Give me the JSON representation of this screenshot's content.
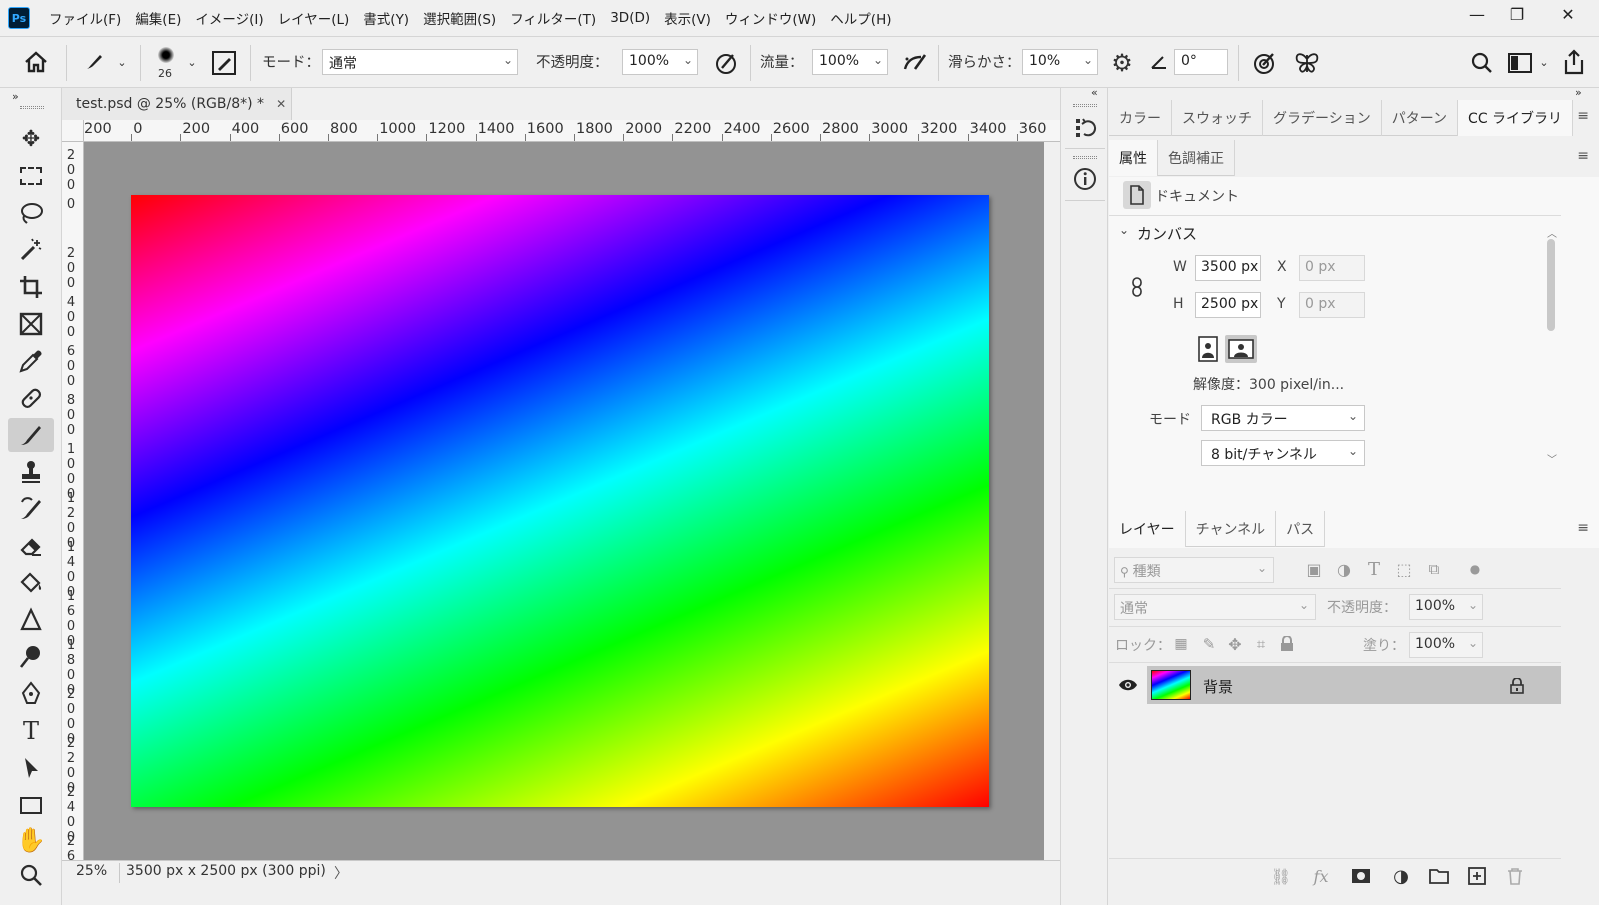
{
  "app": {
    "logo_text": "Ps"
  },
  "menubar": {
    "items": [
      "ファイル(F)",
      "編集(E)",
      "イメージ(I)",
      "レイヤー(L)",
      "書式(Y)",
      "選択範囲(S)",
      "フィルター(T)",
      "3D(D)",
      "表示(V)",
      "ウィンドウ(W)",
      "ヘルプ(H)"
    ]
  },
  "window_controls": {
    "minimize": "—",
    "restore": "❐",
    "close": "✕"
  },
  "options_bar": {
    "brush_size": "26",
    "mode_label": "モード：",
    "mode_value": "通常",
    "opacity_label": "不透明度：",
    "opacity_value": "100%",
    "flow_label": "流量：",
    "flow_value": "100%",
    "smoothing_label": "滑らかさ：",
    "smoothing_value": "10%",
    "angle_value": "0°"
  },
  "document": {
    "tab_title": "test.psd @ 25% (RGB/8*) *",
    "hruler_ticks": [
      "200",
      "0",
      "200",
      "400",
      "600",
      "800",
      "1000",
      "1200",
      "1400",
      "1600",
      "1800",
      "2000",
      "2200",
      "2400",
      "2600",
      "2800",
      "3000",
      "3200",
      "3400",
      "360"
    ],
    "vruler_ticks": [
      "200",
      "0",
      "200",
      "400",
      "600",
      "800",
      "1000",
      "1200",
      "1400",
      "1600",
      "1800",
      "2000",
      "2200",
      "2400",
      "26"
    ],
    "gradient_colors": [
      "#ff0000",
      "#ff00ff",
      "#0000ff",
      "#00ffff",
      "#00ff00",
      "#ffff00",
      "#ff0000"
    ]
  },
  "status_bar": {
    "zoom": "25%",
    "info": "3500 px x 2500 px (300 ppi)",
    "arrow": "〉"
  },
  "top_panel": {
    "tabs": [
      "カラー",
      "スウォッチ",
      "グラデーション",
      "パターン",
      "CC ライブラリ"
    ],
    "active_tab": "CC ライブラリ"
  },
  "properties_panel": {
    "tabs": [
      "属性",
      "色調補正"
    ],
    "doc_label": "ドキュメント",
    "section_title": "カンバス",
    "w_label": "W",
    "w_value": "3500 px",
    "h_label": "H",
    "h_value": "2500 px",
    "x_label": "X",
    "x_value": "0 px",
    "y_label": "Y",
    "y_value": "0 px",
    "resolution": "解像度：300 pixel/in...",
    "mode_label": "モード",
    "mode_value": "RGB カラー",
    "depth_value": "8 bit/チャンネル"
  },
  "layers_panel": {
    "tabs": [
      "レイヤー",
      "チャンネル",
      "パス"
    ],
    "filter_placeholder": "種類",
    "blend_value": "通常",
    "opacity_label": "不透明度：",
    "opacity_value": "100%",
    "lock_label": "ロック：",
    "fill_label": "塗り：",
    "fill_value": "100%",
    "layers": [
      {
        "name": "背景",
        "visible": true,
        "locked": true
      }
    ]
  },
  "colors": {
    "accent": "#31a8ff",
    "panel_bg": "#f0f0f0",
    "pasteboard": "#939393",
    "selected_layer": "#c4c4c4"
  }
}
